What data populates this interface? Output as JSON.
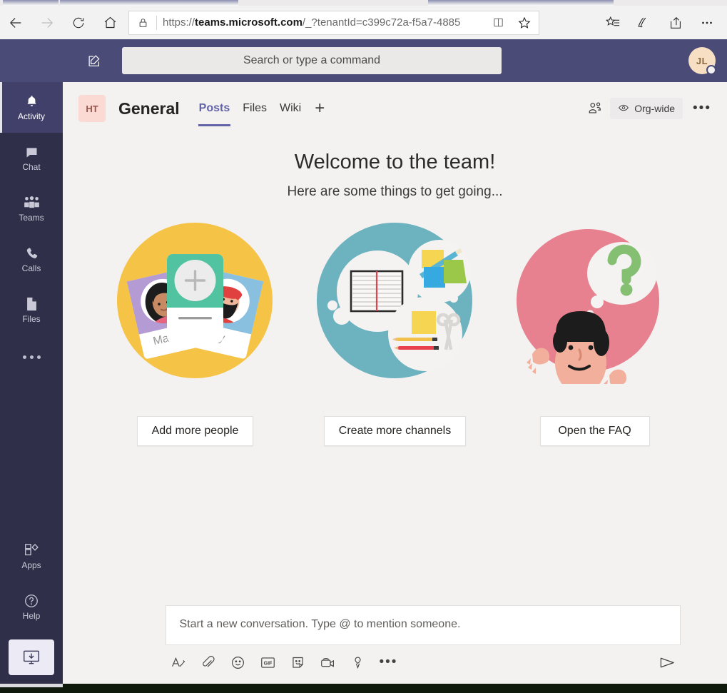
{
  "browser": {
    "back_icon": "back-arrow-icon",
    "forward_icon": "forward-arrow-icon",
    "refresh_icon": "refresh-icon",
    "home_icon": "home-icon",
    "lock_icon": "lock-icon",
    "url_scheme": "https://",
    "url_host": "teams.microsoft.com",
    "url_path": "/_?tenantId=c399c72a-f5a7-4885",
    "reading_view_icon": "reading-view-icon",
    "favorite_icon": "star-icon",
    "hub_icon": "favorites-hub-icon",
    "web_note_icon": "web-note-pen-icon",
    "share_icon": "share-icon",
    "settings_icon": "more-ellipsis-icon"
  },
  "topbar": {
    "compose_icon": "new-chat-compose-icon",
    "search_placeholder": "Search or type a command",
    "avatar_initials": "JL",
    "presence_status": "offline"
  },
  "rail": {
    "items": [
      {
        "label": "Activity",
        "icon": "bell-icon",
        "active": true
      },
      {
        "label": "Chat",
        "icon": "chat-bubble-icon",
        "active": false
      },
      {
        "label": "Teams",
        "icon": "teams-people-icon",
        "active": false
      },
      {
        "label": "Calls",
        "icon": "phone-icon",
        "active": false
      },
      {
        "label": "Files",
        "icon": "file-icon",
        "active": false
      }
    ],
    "more_icon": "more-ellipsis-icon",
    "bottom_items": [
      {
        "label": "Apps",
        "icon": "apps-grid-icon"
      },
      {
        "label": "Help",
        "icon": "help-question-icon"
      }
    ],
    "get_app_icon": "download-desktop-app-icon"
  },
  "channel": {
    "team_initials": "HT",
    "name": "General",
    "tabs": [
      {
        "label": "Posts",
        "active": true
      },
      {
        "label": "Files",
        "active": false
      },
      {
        "label": "Wiki",
        "active": false
      }
    ],
    "add_tab_label": "+",
    "members_icon": "people-roster-icon",
    "visibility_icon": "eye-icon",
    "visibility_label": "Org-wide",
    "more_label": "•••"
  },
  "welcome": {
    "title": "Welcome to the team!",
    "subtitle": "Here are some things to get going...",
    "cards": [
      {
        "button_label": "Add more people",
        "illustration": "people-cards-illustration",
        "circle_color": "#f5c346",
        "person_left_name": "Maxine",
        "person_right_name": "ky"
      },
      {
        "button_label": "Create more channels",
        "illustration": "notebook-supplies-illustration",
        "circle_color": "#6cb2bf"
      },
      {
        "button_label": "Open the FAQ",
        "illustration": "person-question-illustration",
        "circle_color": "#e8818f"
      }
    ]
  },
  "composer": {
    "placeholder": "Start a new conversation. Type @ to mention someone.",
    "tools": [
      {
        "name": "format-text-icon",
        "label": "Format"
      },
      {
        "name": "attach-file-icon",
        "label": "Attach"
      },
      {
        "name": "emoji-icon",
        "label": "Emoji"
      },
      {
        "name": "gif-icon",
        "label": "GIF"
      },
      {
        "name": "sticker-icon",
        "label": "Sticker"
      },
      {
        "name": "meet-now-video-icon",
        "label": "Meet now"
      },
      {
        "name": "praise-badge-icon",
        "label": "Praise"
      },
      {
        "name": "more-options-icon",
        "label": "•••"
      }
    ],
    "send_icon": "send-paper-plane-icon"
  }
}
